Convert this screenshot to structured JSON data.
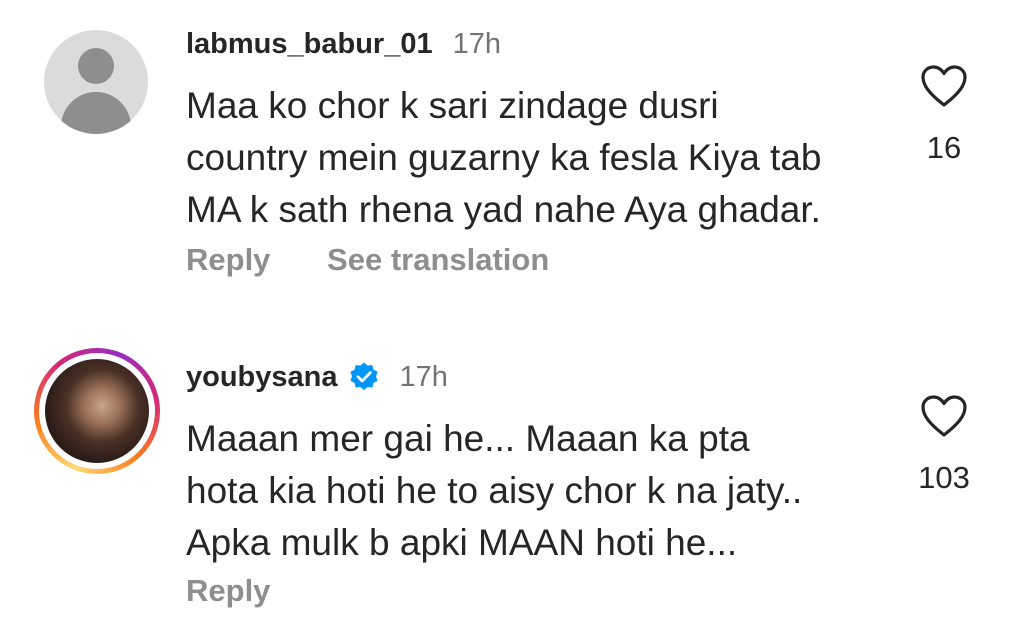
{
  "comments": [
    {
      "username": "labmus_babur_01",
      "time": "17h",
      "verified": false,
      "avatar": "default-avatar",
      "text_lines": [
        "Maa ko chor k sari zindage dusri",
        "country mein guzarny ka fesla Kiya tab",
        "MA k sath rhena yad nahe Aya ghadar."
      ],
      "likes": "16",
      "reply_label": "Reply",
      "translation_label": "See translation"
    },
    {
      "username": "youbysana",
      "time": "17h",
      "verified": true,
      "avatar": "profile-photo",
      "text_lines": [
        "Maaan mer gai he... Maaan ka pta",
        "hota kia hoti he to aisy chor k na jaty..",
        "Apka mulk b apki MAAN hoti he..."
      ],
      "likes": "103",
      "reply_label": "Reply"
    }
  ],
  "colors": {
    "text": "#262626",
    "muted": "#737373",
    "action": "#8e8e8e",
    "verified_badge": "#0095f6"
  },
  "icons": {
    "like": "heart-outline-icon",
    "verified": "verified-badge-icon",
    "default_avatar": "person-placeholder-icon"
  }
}
